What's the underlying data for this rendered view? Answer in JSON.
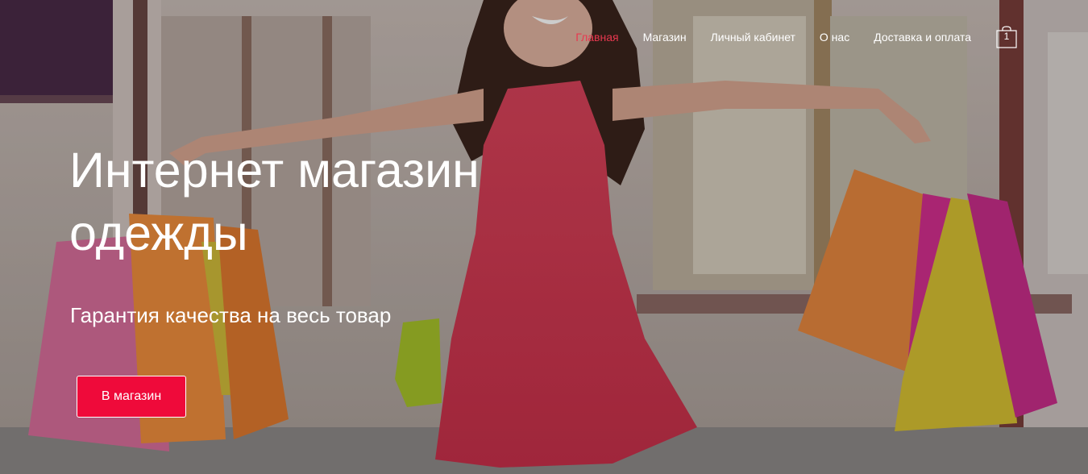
{
  "nav": {
    "items": [
      {
        "label": "Главная",
        "active": true
      },
      {
        "label": "Магазин",
        "active": false
      },
      {
        "label": "Личный кабинет",
        "active": false
      },
      {
        "label": "О нас",
        "active": false
      },
      {
        "label": "Доставка и оплата",
        "active": false
      }
    ],
    "cart_count": "1",
    "active_color": "#e8384f"
  },
  "hero": {
    "title": "Интернет магазин одежды",
    "subtitle": "Гарантия качества на весь товар",
    "cta_label": "В магазин",
    "cta_color": "#ef0a3a",
    "image_icon": "woman-with-shopping-bags-photo"
  }
}
